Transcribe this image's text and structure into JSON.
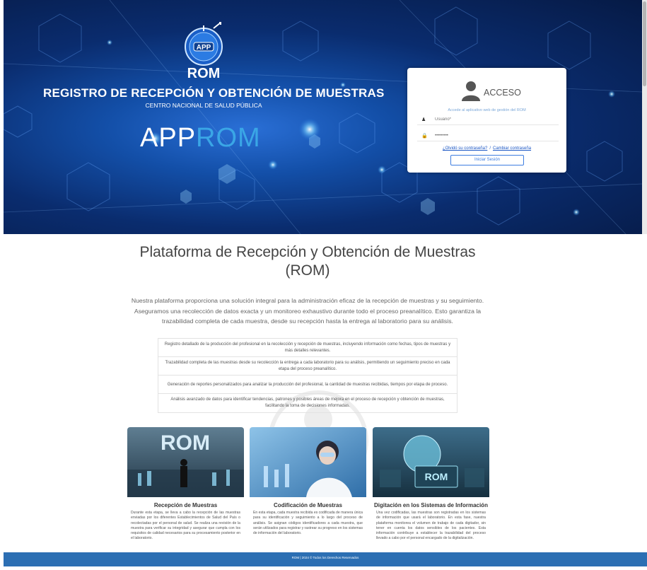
{
  "hero": {
    "logo_text": "APP",
    "logo_caption": "ROM",
    "title": "REGISTRO DE RECEPCIÓN Y OBTENCIÓN DE MUESTRAS",
    "subtitle": "CENTRO NACIONAL DE SALUD PÚBLICA",
    "brand_part1": "APP",
    "brand_part2": "ROM"
  },
  "login": {
    "title": "ACCESO",
    "description": "Accede al aplicativo web de gestión del ROM",
    "username_placeholder": "Usuario*",
    "password_value": "•••••••••",
    "forgot_link": "¿Olvidó su contraseña?",
    "separator": "/",
    "change_link": "Cambiar contraseña",
    "submit_label": "Iniciar Sesión"
  },
  "main": {
    "title": "Plataforma de Recepción y Obtención de Muestras (ROM)",
    "intro": "Nuestra plataforma proporciona una solución integral para la administración eficaz de la recepción de muestras y su seguimiento. Aseguramos una recolección de datos exacta y un monitoreo exhaustivo durante todo el proceso preanalítico. Esto garantiza la trazabilidad completa de cada muestra, desde su recepción hasta la entrega al laboratorio para su análisis.",
    "features": [
      "Registro detallado de la producción del profesional en la recolección y recepción de muestras, incluyendo información como fechas, tipos de muestras y más detalles relevantes.",
      "Trazabilidad completa de las muestras desde su recolección la entrega a cada laboratorio para su análisis, permitiendo un seguimiento preciso en cada etapa del proceso preanalítico.",
      "Generación de reportes personalizados para analizar la producción del profesional, la cantidad de muestras recibidas, tiempos por etapa de proceso.",
      "Análisis avanzado de datos para identificar tendencias, patrones y posibles áreas de mejora en el proceso de recepción y obtención de muestras, facilitando la toma de decisiones informadas."
    ]
  },
  "cards": [
    {
      "title": "Recepción de Muestras",
      "image_text": "ROM",
      "text": "Durante esta etapa, se lleva a cabo la recepción de las muestras enviadas por los diferentes Establecimientos de Salud del País o recolectadas por el personal de salud. Se realiza una revisión de la muestra para verificar su integridad y asegurar que cumpla con los requisitos de calidad necesarios para su procesamiento posterior en el laboratorio."
    },
    {
      "title": "Codificación de Muestras",
      "text": "En esta etapa, cada muestra recibida es codificada de manera única para su identificación y seguimiento a lo largo del proceso de análisis. Se asignan códigos identificadores a cada muestra, que serán utilizados para registrar y rastrear su progreso en los sistemas de información del laboratorio."
    },
    {
      "title": "Digitación en los Sistemas de Información",
      "image_text": "ROM",
      "text": "Una vez codificadas, las muestras son registradas en los sistemas de información que usará el laboratorio. En esta fase, nuestra plataforma monitorea el volumen de trabajo de cada digitador, sin tener en cuenta los datos sensibles de los pacientes. Esta información contribuye a establecer la trazabilidad del proceso llevado a cabo por el personal encargado de la digitalización."
    }
  ],
  "footer": {
    "text": "ROM | 2024 © Todos los Derechos Reservados"
  },
  "icons": {
    "user": "user-silhouette-icon",
    "username": "person-icon",
    "password": "lock-icon"
  },
  "colors": {
    "accent": "#3d7de0",
    "footer": "#2c6fb3",
    "brand_blue": "#3aa6e6"
  }
}
